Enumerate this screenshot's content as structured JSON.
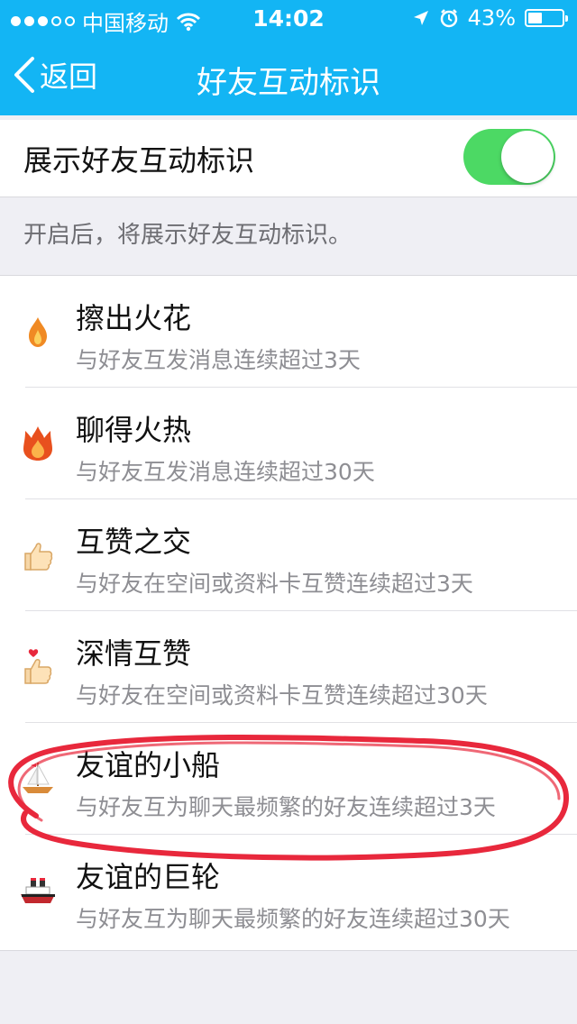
{
  "status_bar": {
    "carrier": "中国移动",
    "time": "14:02",
    "battery": "43%",
    "battery_level": 0.43,
    "signal_dots": 5,
    "signal_filled": 3
  },
  "nav": {
    "back_label": "返回",
    "title": "好友互动标识"
  },
  "setting": {
    "label": "展示好友互动标识",
    "enabled": true,
    "hint": "开启后，将展示好友互动标识。"
  },
  "items": [
    {
      "title": "擦出火花",
      "desc": "与好友互发消息连续超过3天",
      "icon": "flame-icon"
    },
    {
      "title": "聊得火热",
      "desc": "与好友互发消息连续超过30天",
      "icon": "big-flame-icon"
    },
    {
      "title": "互赞之交",
      "desc": "与好友在空间或资料卡互赞连续超过3天",
      "icon": "thumbs-up-icon"
    },
    {
      "title": "深情互赞",
      "desc": "与好友在空间或资料卡互赞连续超过30天",
      "icon": "heart-thumbs-up-icon"
    },
    {
      "title": "友谊的小船",
      "desc": "与好友互为聊天最频繁的好友连续超过3天",
      "icon": "sailboat-icon"
    },
    {
      "title": "友谊的巨轮",
      "desc": "与好友互为聊天最频繁的好友连续超过30天",
      "icon": "ship-icon"
    }
  ],
  "colors": {
    "header": "#13b5f4",
    "switch_on": "#4cd964",
    "annotation": "#e8283c"
  }
}
